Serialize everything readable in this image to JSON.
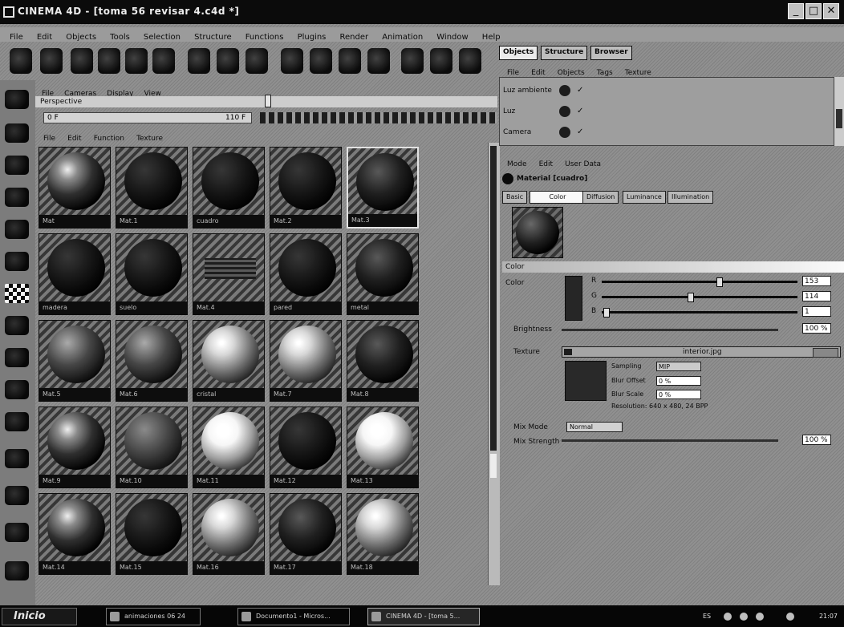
{
  "window": {
    "title": "CINEMA 4D - [toma 56 revisar 4.c4d *]",
    "min": "_",
    "max": "□",
    "close": "✕"
  },
  "menubar": [
    "File",
    "Edit",
    "Objects",
    "Tools",
    "Selection",
    "Structure",
    "Functions",
    "Plugins",
    "Render",
    "Animation",
    "Window",
    "Help"
  ],
  "toolbar_icons": [
    "undo-icon",
    "redo-icon",
    "live-select-icon",
    "move-icon",
    "scale-icon",
    "rotate-icon",
    "x-axis-icon",
    "y-axis-icon",
    "z-axis-icon",
    "render-view-icon",
    "render-icon",
    "render-settings-icon",
    "cube-icon",
    "nurbs-icon",
    "deformer-icon"
  ],
  "left_tools": [
    "camera-icon",
    "model-icon",
    "object-icon",
    "point-icon",
    "edge-icon",
    "texture-icon",
    "checker-icon",
    "sphere-tool-icon",
    "brush-icon",
    "pen-icon",
    "paint-icon",
    "axis-icon",
    "magnet-icon",
    "knife-icon",
    "hand-icon"
  ],
  "material_manager": {
    "top_menu": [
      "File",
      "Cameras",
      "Display",
      "View"
    ],
    "timeline_label": "Perspective",
    "frame_start": "0 F",
    "frame_end": "110 F",
    "menu": [
      "File",
      "Edit",
      "Function",
      "Texture"
    ],
    "materials": [
      {
        "name": "Mat",
        "sphere": "shiny",
        "selected": false
      },
      {
        "name": "Mat.1",
        "sphere": "dark",
        "selected": false
      },
      {
        "name": "cuadro",
        "sphere": "dark",
        "selected": false
      },
      {
        "name": "Mat.2",
        "sphere": "dark",
        "selected": false
      },
      {
        "name": "Mat.3",
        "sphere": "dark-shine",
        "selected": true
      },
      {
        "name": "madera",
        "sphere": "dark",
        "selected": false
      },
      {
        "name": "suelo",
        "sphere": "dark",
        "selected": false
      },
      {
        "name": "Mat.4",
        "sphere": "stripes",
        "selected": false
      },
      {
        "name": "pared",
        "sphere": "dark",
        "selected": false
      },
      {
        "name": "metal",
        "sphere": "dark-shine",
        "selected": false
      },
      {
        "name": "Mat.5",
        "sphere": "mid",
        "selected": false
      },
      {
        "name": "Mat.6",
        "sphere": "mid",
        "selected": false
      },
      {
        "name": "cristal",
        "sphere": "bright",
        "selected": false
      },
      {
        "name": "Mat.7",
        "sphere": "bright",
        "selected": false
      },
      {
        "name": "Mat.8",
        "sphere": "dark-shine",
        "selected": false
      },
      {
        "name": "Mat.9",
        "sphere": "shiny",
        "selected": false
      },
      {
        "name": "Mat.10",
        "sphere": "textured",
        "selected": false
      },
      {
        "name": "Mat.11",
        "sphere": "bright-white",
        "selected": false
      },
      {
        "name": "Mat.12",
        "sphere": "dark",
        "selected": false
      },
      {
        "name": "Mat.13",
        "sphere": "bright-white",
        "selected": false
      },
      {
        "name": "Mat.14",
        "sphere": "shiny",
        "selected": false
      },
      {
        "name": "Mat.15",
        "sphere": "dark",
        "selected": false
      },
      {
        "name": "Mat.16",
        "sphere": "bright",
        "selected": false
      },
      {
        "name": "Mat.17",
        "sphere": "dark-shine",
        "selected": false
      },
      {
        "name": "Mat.18",
        "sphere": "bright",
        "selected": false
      }
    ]
  },
  "object_manager": {
    "tabs": [
      "Objects",
      "Structure",
      "Browser"
    ],
    "menu": [
      "File",
      "Edit",
      "Objects",
      "Tags",
      "Texture"
    ],
    "rows": [
      "Luz ambiente",
      "Luz",
      "Camera"
    ]
  },
  "attributes": {
    "menu": [
      "Mode",
      "Edit",
      "User Data"
    ],
    "title": "Material [cuadro]",
    "tabs": [
      "Basic",
      "Color",
      "Diffusion",
      "Luminance",
      "Illumination"
    ],
    "active_tab": "Color",
    "section": "Color",
    "color_label": "Color",
    "channels": [
      {
        "label": "R",
        "value": "153",
        "fraction": 0.6
      },
      {
        "label": "G",
        "value": "114",
        "fraction": 0.45
      },
      {
        "label": "B",
        "value": "1",
        "fraction": 0.01
      }
    ],
    "brightness_label": "Brightness",
    "brightness_value": "100 %",
    "texture_label": "Texture",
    "texture_name": "interior.jpg",
    "sampling_label": "Sampling",
    "sampling_value": "MIP",
    "blur_offset_label": "Blur Offset",
    "blur_offset_value": "0 %",
    "blur_scale_label": "Blur Scale",
    "blur_scale_value": "0 %",
    "resolution": "Resolution: 640 x 480, 24 BPP",
    "mix_mode_label": "Mix Mode",
    "mix_mode_value": "Normal",
    "mix_strength_label": "Mix Strength",
    "mix_strength_value": "100 %"
  },
  "taskbar": {
    "start": "Inicio",
    "tasks": [
      {
        "label": "animaciones 06 24",
        "active": false
      },
      {
        "label": "Documento1 - Micros...",
        "active": false
      },
      {
        "label": "CINEMA 4D - [toma 5...",
        "active": true
      }
    ],
    "lang": "ES",
    "clock": "21:07"
  }
}
